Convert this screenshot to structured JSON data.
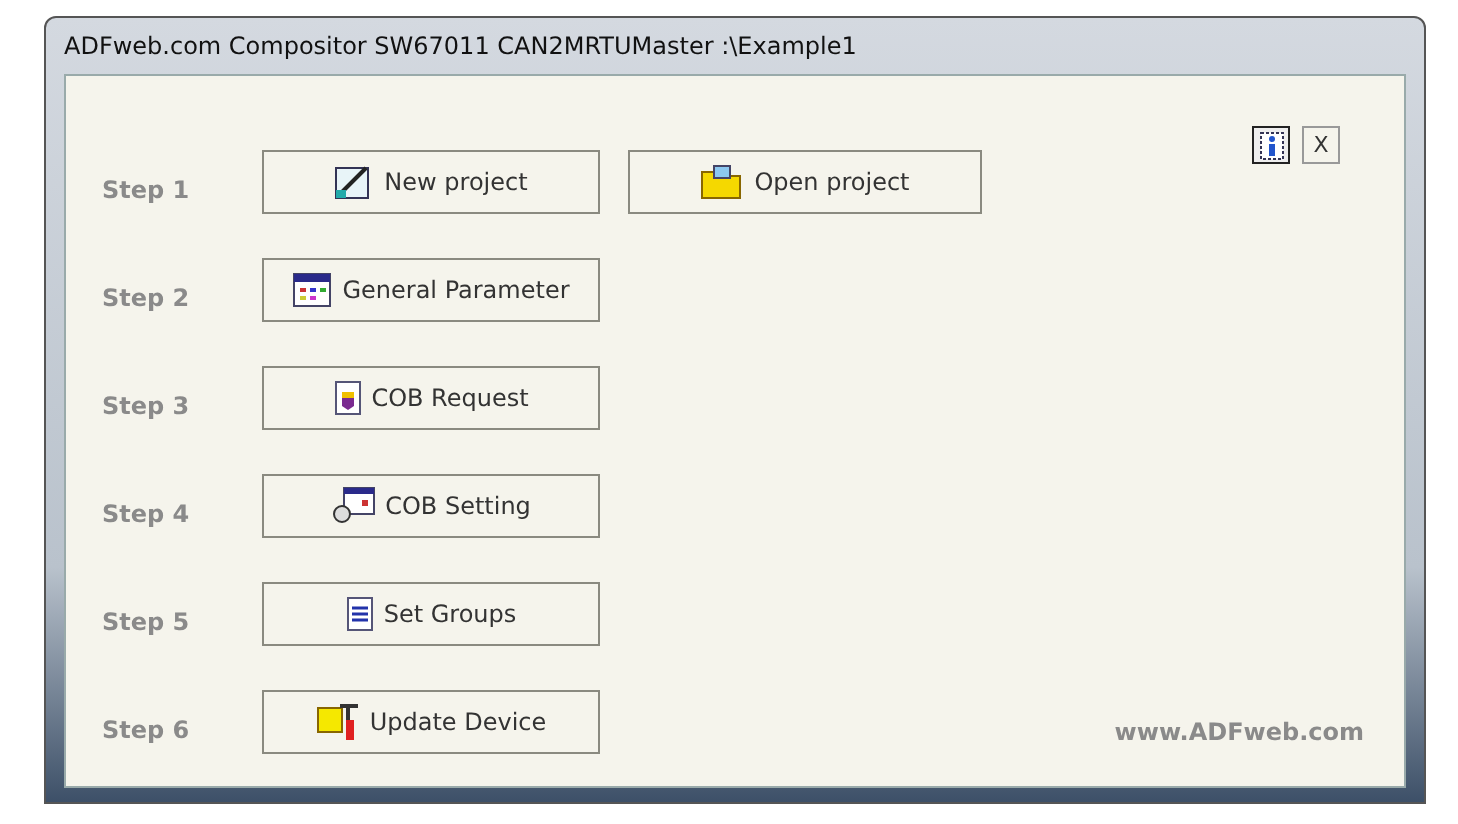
{
  "window": {
    "title": "ADFweb.com Compositor SW67011 CAN2MRTUMaster :\\Example1"
  },
  "close_button": "X",
  "steps": [
    {
      "label": "Step 1",
      "buttons": [
        {
          "label": "New project",
          "kind": "new"
        },
        {
          "label": "Open project",
          "kind": "open"
        }
      ]
    },
    {
      "label": "Step 2",
      "buttons": [
        {
          "label": "General Parameter",
          "kind": "params"
        }
      ]
    },
    {
      "label": "Step 3",
      "buttons": [
        {
          "label": "COB Request",
          "kind": "request"
        }
      ]
    },
    {
      "label": "Step 4",
      "buttons": [
        {
          "label": "COB Setting",
          "kind": "setting"
        }
      ]
    },
    {
      "label": "Step 5",
      "buttons": [
        {
          "label": "Set Groups",
          "kind": "groups"
        }
      ]
    },
    {
      "label": "Step 6",
      "buttons": [
        {
          "label": "Update Device",
          "kind": "update"
        }
      ]
    }
  ],
  "footer": "www.ADFweb.com"
}
